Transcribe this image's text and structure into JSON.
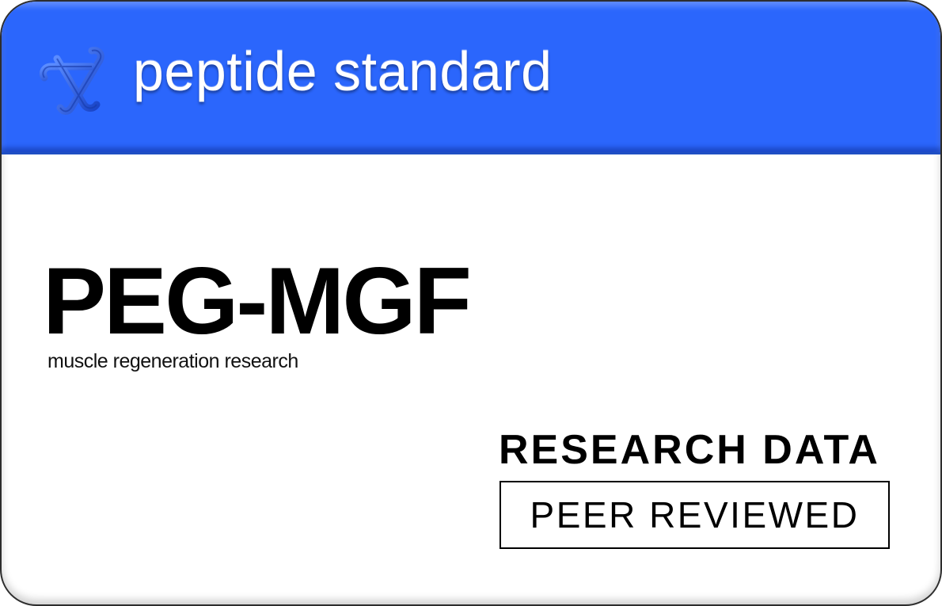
{
  "header": {
    "brand_name": "peptide standard",
    "logo_icon": "triangle-knot-logo-icon",
    "color": "#2b66fc"
  },
  "product": {
    "name": "PEG-MGF",
    "subtitle": "muscle regeneration research"
  },
  "labels": {
    "research_data": "RESEARCH DATA",
    "peer_reviewed": "PEER REVIEWED"
  }
}
